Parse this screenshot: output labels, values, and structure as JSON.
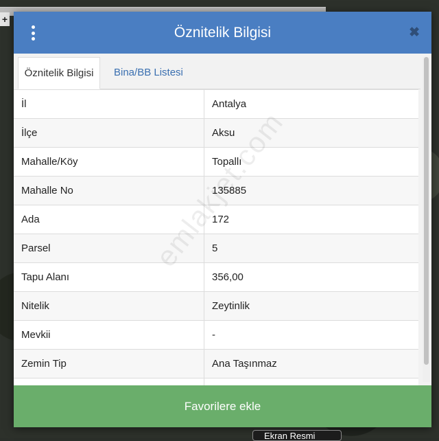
{
  "modal": {
    "title": "Öznitelik Bilgisi",
    "close_symbol": "✖",
    "menu_icon": "kebab-menu-icon"
  },
  "tabs": [
    {
      "label": "Öznitelik Bilgisi",
      "active": true
    },
    {
      "label": "Bina/BB Listesi",
      "active": false
    }
  ],
  "rows": [
    {
      "key": "İl",
      "value": "Antalya"
    },
    {
      "key": "İlçe",
      "value": "Aksu"
    },
    {
      "key": "Mahalle/Köy",
      "value": "Topallı"
    },
    {
      "key": "Mahalle No",
      "value": "135885"
    },
    {
      "key": "Ada",
      "value": "172"
    },
    {
      "key": "Parsel",
      "value": "5"
    },
    {
      "key": "Tapu Alanı",
      "value": "356,00"
    },
    {
      "key": "Nitelik",
      "value": "Zeytinlik"
    },
    {
      "key": "Mevkii",
      "value": "-"
    },
    {
      "key": "Zemin Tip",
      "value": "Ana Taşınmaz"
    },
    {
      "key": "",
      "value": ""
    }
  ],
  "watermark": "emlakjet.com",
  "footer": {
    "button_label": "Favorilere ekle"
  },
  "map": {
    "zoom_in_label": "+",
    "bottom_tab_label": "Ekran Resmi"
  },
  "colors": {
    "header": "#4a7ec2",
    "footer": "#6aae6b",
    "tab_link": "#3a6fb0"
  }
}
